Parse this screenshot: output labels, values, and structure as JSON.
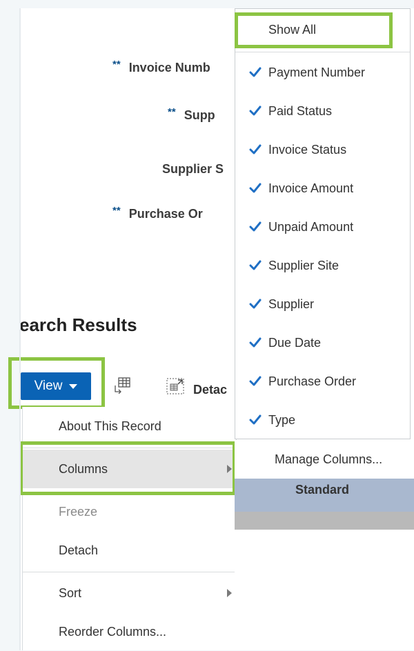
{
  "form": {
    "req_marker": "**",
    "fields": [
      {
        "label": "Invoice Numb",
        "required": true
      },
      {
        "label": "Supp",
        "required": true
      },
      {
        "label": "Supplier S",
        "required": false
      },
      {
        "label": "Purchase Or",
        "required": true
      }
    ]
  },
  "search_results": {
    "title": "earch Results"
  },
  "toolbar": {
    "view_label": "View",
    "detach_label": "Detac"
  },
  "view_menu": {
    "items": [
      {
        "label": "About This Record",
        "enabled": true,
        "submenu": false
      },
      {
        "label": "Columns",
        "enabled": true,
        "submenu": true,
        "selected": true
      },
      {
        "label": "Freeze",
        "enabled": false,
        "submenu": false
      },
      {
        "label": "Detach",
        "enabled": true,
        "submenu": false
      },
      {
        "label": "Sort",
        "enabled": true,
        "submenu": true
      },
      {
        "label": "Reorder Columns...",
        "enabled": true,
        "submenu": false
      }
    ]
  },
  "columns_menu": {
    "show_all": "Show All",
    "items": [
      {
        "label": "Payment Number",
        "checked": true
      },
      {
        "label": "Paid Status",
        "checked": true
      },
      {
        "label": "Invoice Status",
        "checked": true
      },
      {
        "label": "Invoice Amount",
        "checked": true
      },
      {
        "label": "Unpaid Amount",
        "checked": true
      },
      {
        "label": "Supplier Site",
        "checked": true
      },
      {
        "label": "Supplier",
        "checked": true
      },
      {
        "label": "Due Date",
        "checked": true
      },
      {
        "label": "Purchase Order",
        "checked": true
      },
      {
        "label": "Type",
        "checked": true
      }
    ],
    "manage_columns": "Manage Columns...",
    "standard_label": "Standard"
  },
  "colors": {
    "highlight": "#8cc443",
    "view_button": "#0a63b5",
    "checkmark": "#1f6fc4",
    "required": "#0b4f8a"
  }
}
